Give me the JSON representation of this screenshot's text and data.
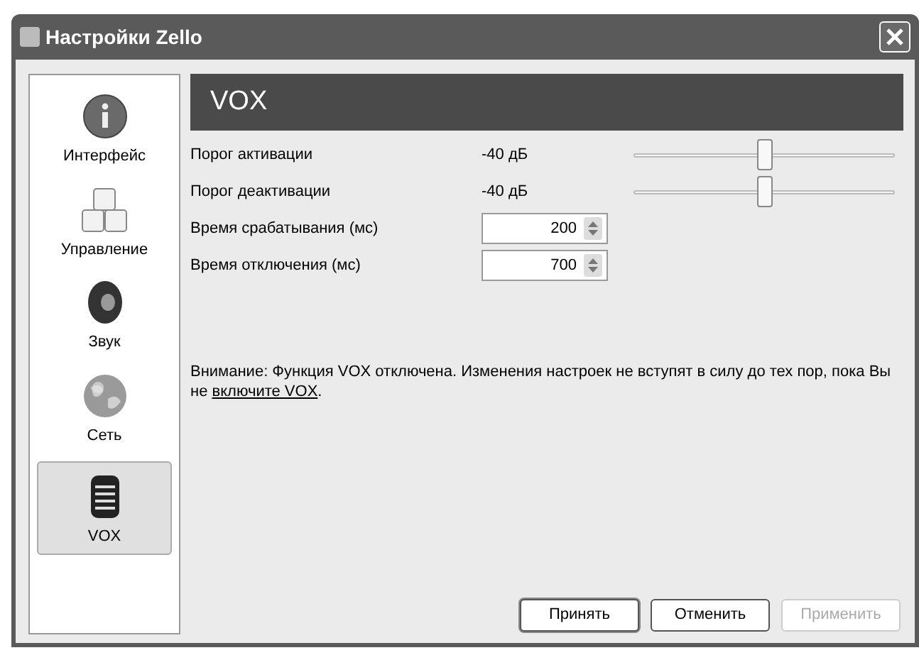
{
  "window": {
    "title": "Настройки Zello"
  },
  "sidebar": {
    "items": [
      {
        "label": "Интерфейс",
        "kind": "info",
        "selected": false
      },
      {
        "label": "Управление",
        "kind": "keys",
        "selected": false
      },
      {
        "label": "Звук",
        "kind": "speaker",
        "selected": false
      },
      {
        "label": "Сеть",
        "kind": "globe",
        "selected": false
      },
      {
        "label": "VOX",
        "kind": "mic",
        "selected": true
      }
    ]
  },
  "header": "VOX",
  "settings": [
    {
      "kind": "slider",
      "label": "Порог активации",
      "reading": "-40 дБ",
      "level": 0.5
    },
    {
      "kind": "slider",
      "label": "Порог деактивации",
      "reading": "-40 дБ",
      "level": 0.5
    },
    {
      "kind": "spin",
      "label": "Время срабатывания (мс)",
      "value": "200"
    },
    {
      "kind": "spin",
      "label": "Время отключения (мс)",
      "value": "700"
    }
  ],
  "note": {
    "before": "Внимание: Функция VOX отключена. Изменения настроек не вступят в силу до тех пор, пока Вы не ",
    "link": "включите VOX",
    "after": "."
  },
  "buttons": [
    {
      "label": "Принять",
      "disabled": false,
      "default": true
    },
    {
      "label": "Отменить",
      "disabled": false,
      "default": false
    },
    {
      "label": "Применить",
      "disabled": true,
      "default": false
    }
  ]
}
